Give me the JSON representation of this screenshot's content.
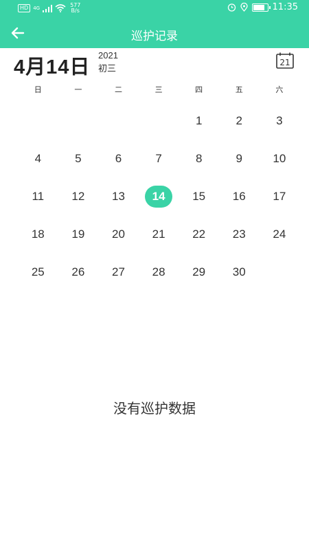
{
  "status_bar": {
    "hd": "HD",
    "network": "4G",
    "speed_value": "577",
    "speed_unit": "B/s",
    "battery_level": "73",
    "time": "11:35"
  },
  "header": {
    "title": "巡护记录"
  },
  "date_header": {
    "big_date": "4月14日",
    "year": "2021",
    "lunar": "初三",
    "today_icon_day": "21"
  },
  "weekdays": [
    "日",
    "一",
    "二",
    "三",
    "四",
    "五",
    "六"
  ],
  "calendar": {
    "leading_blanks": 4,
    "days": [
      "1",
      "2",
      "3",
      "4",
      "5",
      "6",
      "7",
      "8",
      "9",
      "10",
      "11",
      "12",
      "13",
      "14",
      "15",
      "16",
      "17",
      "18",
      "19",
      "20",
      "21",
      "22",
      "23",
      "24",
      "25",
      "26",
      "27",
      "28",
      "29",
      "30"
    ],
    "selected": "14",
    "accent_color": "#3ad3a6"
  },
  "empty_state": {
    "message": "没有巡护数据"
  }
}
